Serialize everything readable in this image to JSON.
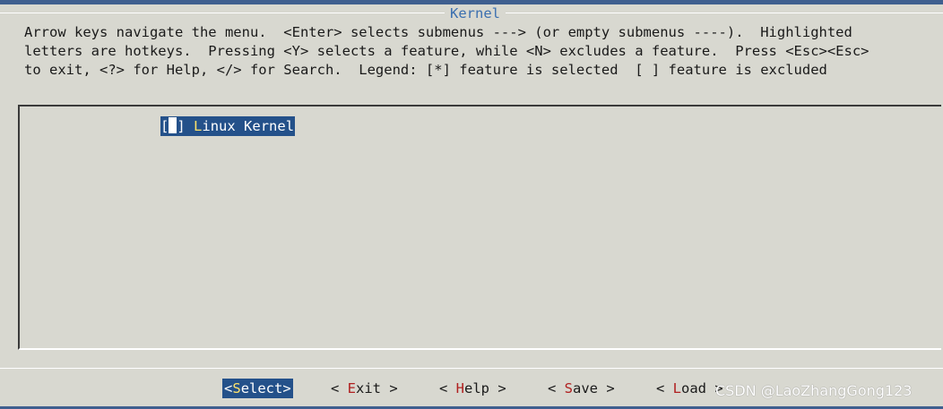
{
  "dialog": {
    "title": "Kernel",
    "help_lines": [
      "Arrow keys navigate the menu.  <Enter> selects submenus ---> (or empty submenus ----).  Highlighted",
      "letters are hotkeys.  Pressing <Y> selects a feature, while <N> excludes a feature.  Press <Esc><Esc>",
      "to exit, <?> for Help, </> for Search.  Legend: [*] feature is selected  [ ] feature is excluded"
    ]
  },
  "menu": {
    "items": [
      {
        "checkbox_open": "[",
        "checkbox_close": "]",
        "hotkey": "L",
        "label_rest": "inux Kernel",
        "selected": false
      }
    ]
  },
  "buttons": [
    {
      "open": "<",
      "hotkey": "S",
      "rest": "elect",
      "close": ">",
      "active": true
    },
    {
      "open": "< ",
      "hotkey": "E",
      "rest": "xit",
      "close": " >",
      "active": false
    },
    {
      "open": "< ",
      "hotkey": "H",
      "rest": "elp",
      "close": " >",
      "active": false
    },
    {
      "open": "< ",
      "hotkey": "S",
      "rest": "ave",
      "close": " >",
      "active": false
    },
    {
      "open": "< ",
      "hotkey": "L",
      "rest": "oad",
      "close": " >",
      "active": false
    }
  ],
  "watermark": "CSDN @LaoZhangGong123",
  "colors": {
    "background": "#d8d8d0",
    "highlight": "#24518a",
    "hotkey": "#b02020",
    "title": "#3b6fb0"
  }
}
